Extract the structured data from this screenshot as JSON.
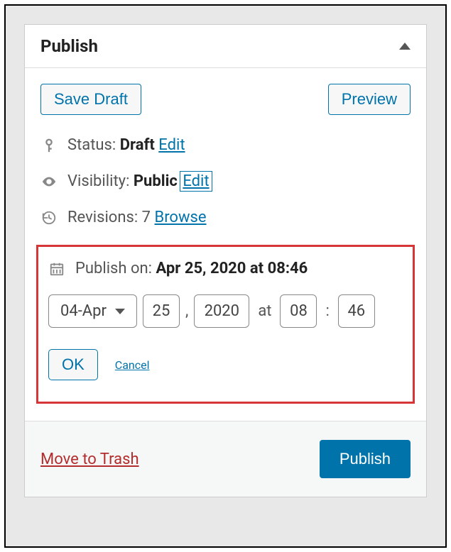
{
  "header": {
    "title": "Publish"
  },
  "actions": {
    "save_draft": "Save Draft",
    "preview": "Preview"
  },
  "status": {
    "label": "Status:",
    "value": "Draft",
    "edit": "Edit"
  },
  "visibility": {
    "label": "Visibility:",
    "value": "Public",
    "edit": "Edit"
  },
  "revisions": {
    "label": "Revisions:",
    "value": "7",
    "browse": "Browse"
  },
  "schedule": {
    "label": "Publish on:",
    "display": "Apr 25, 2020 at 08:46",
    "month": "04-Apr",
    "day": "25",
    "year": "2020",
    "at": "at",
    "hour": "08",
    "minute": "46",
    "ok": "OK",
    "cancel": "Cancel"
  },
  "footer": {
    "trash": "Move to Trash",
    "publish": "Publish"
  }
}
